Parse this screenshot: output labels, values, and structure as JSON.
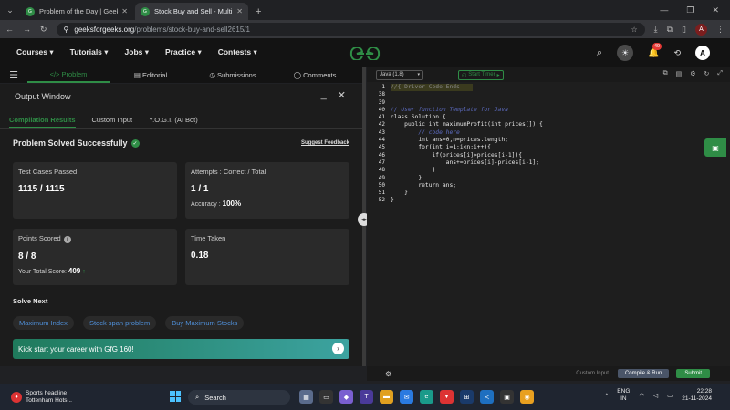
{
  "browser": {
    "tabs": [
      {
        "title": "Problem of the Day | GeeksforG",
        "active": false
      },
      {
        "title": "Stock Buy and Sell - Multiple Tr",
        "active": true
      }
    ],
    "url_host": "geeksforgeeks.org",
    "url_path": "/problems/stock-buy-and-sell2615/1",
    "profile_initial": "A"
  },
  "nav": {
    "items": [
      "Courses ▾",
      "Tutorials ▾",
      "Jobs ▾",
      "Practice ▾",
      "Contests ▾"
    ],
    "logo": "GfG",
    "notif_count": "49",
    "avatar": "A"
  },
  "left_tabs": {
    "problem": "</> Problem",
    "editorial": "Editorial",
    "submissions": "Submissions",
    "comments": "Comments"
  },
  "output": {
    "title": "Output Window",
    "tabs": [
      "Compilation Results",
      "Custom Input",
      "Y.O.G.I. (AI Bot)"
    ],
    "status": "Problem Solved Successfully",
    "feedback": "Suggest Feedback",
    "test_cases_label": "Test Cases Passed",
    "test_cases_value": "1115 / 1115",
    "attempts_label": "Attempts : Correct / Total",
    "attempts_value": "1 / 1",
    "accuracy_label": "Accuracy :",
    "accuracy_value": "100%",
    "points_label": "Points Scored",
    "points_value": "8 / 8",
    "total_score_label": "Your Total Score:",
    "total_score_value": "409",
    "time_label": "Time Taken",
    "time_value": "0.18",
    "solve_next": "Solve Next",
    "next_problems": [
      "Maximum Index",
      "Stock span problem",
      "Buy Maximum Stocks"
    ],
    "career_banner": "Kick start your career with GfG 160!"
  },
  "editor": {
    "language": "Java (1.8)",
    "timer": "Start Timer",
    "line_numbers": [
      "1",
      "38",
      "39",
      "40",
      "41",
      "42",
      "43",
      "44",
      "45",
      "46",
      "47",
      "48",
      "49",
      "50",
      "51",
      "52"
    ],
    "lines": [
      "//{ Driver Code Ends",
      "",
      "",
      "// User function Template for Java",
      "class Solution {",
      "    public int maximumProfit(int prices[]) {",
      "        // code here",
      "        int ans=0,n=prices.length;",
      "        for(int i=1;i<n;i++){",
      "            if(prices[i]>prices[i-1]){",
      "                ans+=prices[i]-prices[i-1];",
      "            }",
      "        }",
      "        return ans;",
      "    }",
      "}"
    ],
    "custom_input": "Custom Input",
    "compile_run": "Compile & Run",
    "submit": "Submit"
  },
  "taskbar": {
    "news_title": "Sports headline",
    "news_sub": "Tottenham Hots...",
    "search": "Search",
    "lang_1": "ENG",
    "lang_2": "IN",
    "time": "22:28",
    "date": "21-11-2024"
  }
}
